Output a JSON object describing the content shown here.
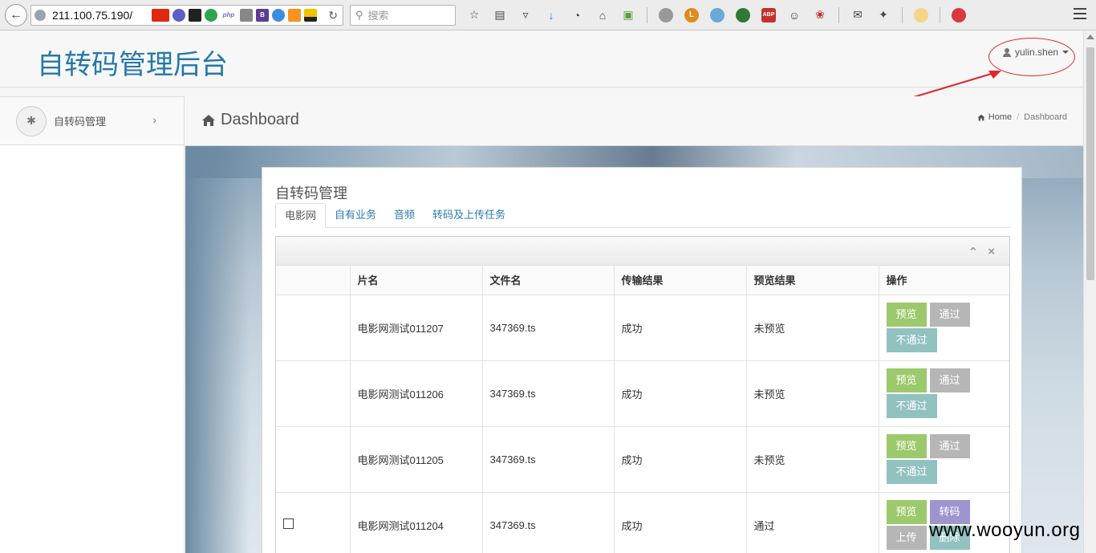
{
  "browser": {
    "url": "211.100.75.190/",
    "search_placeholder": "搜索",
    "addon_labels": [
      "php",
      "B"
    ]
  },
  "header": {
    "app_title": "自转码管理后台",
    "user_name": "yulin.shen"
  },
  "sidebar": {
    "items": [
      {
        "label": "自转码管理"
      }
    ]
  },
  "content_header": {
    "title": "Dashboard",
    "breadcrumb": {
      "home": "Home",
      "current": "Dashboard"
    }
  },
  "panel": {
    "title": "自转码管理",
    "tabs": [
      {
        "label": "电影网",
        "active": true
      },
      {
        "label": "自有业务"
      },
      {
        "label": "音频"
      },
      {
        "label": "转码及上传任务"
      }
    ]
  },
  "table": {
    "columns": [
      "",
      "片名",
      "文件名",
      "传输结果",
      "预览结果",
      "操作"
    ],
    "rows": [
      {
        "checkbox": false,
        "name": "电影网测试011207",
        "file": "347369.ts",
        "transfer": "成功",
        "preview": "未预览",
        "buttons": [
          "预览",
          "通过",
          "不通过"
        ]
      },
      {
        "checkbox": false,
        "name": "电影网测试011206",
        "file": "347369.ts",
        "transfer": "成功",
        "preview": "未预览",
        "buttons": [
          "预览",
          "通过",
          "不通过"
        ]
      },
      {
        "checkbox": false,
        "name": "电影网测试011205",
        "file": "347369.ts",
        "transfer": "成功",
        "preview": "未预览",
        "buttons": [
          "预览",
          "通过",
          "不通过"
        ]
      },
      {
        "checkbox": true,
        "name": "电影网测试011204",
        "file": "347369.ts",
        "transfer": "成功",
        "preview": "通过",
        "buttons": [
          "预览",
          "转码",
          "上传",
          "删除"
        ]
      }
    ]
  },
  "watermark": "www.wooyun.org",
  "colors": {
    "title_blue": "#2478a9",
    "link_blue": "#2a7ab0",
    "btn_preview_green": "#9cc96b",
    "btn_pass_gray": "#b6b6b6",
    "btn_reject_teal": "#91c2c0",
    "btn_transcode_purple": "#9d95cf",
    "annotation_red": "#e0262a"
  }
}
